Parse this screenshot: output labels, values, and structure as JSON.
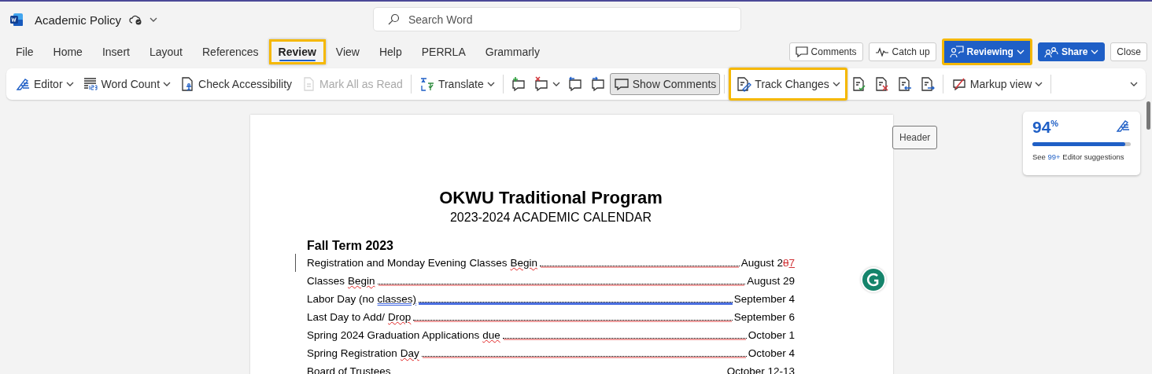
{
  "app": {
    "doc_title": "Academic Policy",
    "search_placeholder": "Search Word"
  },
  "menu_tabs": [
    {
      "label": "File",
      "selected": false,
      "highlighted": false
    },
    {
      "label": "Home",
      "selected": false,
      "highlighted": false
    },
    {
      "label": "Insert",
      "selected": false,
      "highlighted": false
    },
    {
      "label": "Layout",
      "selected": false,
      "highlighted": false
    },
    {
      "label": "References",
      "selected": false,
      "highlighted": false
    },
    {
      "label": "Review",
      "selected": true,
      "highlighted": true
    },
    {
      "label": "View",
      "selected": false,
      "highlighted": false
    },
    {
      "label": "Help",
      "selected": false,
      "highlighted": false
    },
    {
      "label": "PERRLA",
      "selected": false,
      "highlighted": false
    },
    {
      "label": "Grammarly",
      "selected": false,
      "highlighted": false
    }
  ],
  "header_buttons": [
    {
      "kind": "outline",
      "label": "Comments",
      "highlighted": false,
      "dropdown": false
    },
    {
      "kind": "outline",
      "label": "Catch up",
      "highlighted": false,
      "dropdown": false
    },
    {
      "kind": "primary",
      "label": "Reviewing",
      "highlighted": true,
      "dropdown": true
    },
    {
      "kind": "primary",
      "label": "Share",
      "highlighted": false,
      "dropdown": true
    },
    {
      "kind": "plain",
      "label": "Close",
      "highlighted": false,
      "dropdown": false
    }
  ],
  "ribbon": [
    {
      "kind": "button",
      "label": "Editor",
      "dropdown": true,
      "disabled": false,
      "selected": false,
      "highlighted": false
    },
    {
      "kind": "button",
      "label": "Word Count",
      "dropdown": true,
      "disabled": false,
      "selected": false,
      "highlighted": false
    },
    {
      "kind": "button",
      "label": "Check Accessibility",
      "dropdown": false,
      "disabled": false,
      "selected": false,
      "highlighted": false
    },
    {
      "kind": "button",
      "label": "Mark All as Read",
      "dropdown": false,
      "disabled": true,
      "selected": false,
      "highlighted": false
    },
    {
      "kind": "separator"
    },
    {
      "kind": "button",
      "label": "Translate",
      "dropdown": true,
      "disabled": false,
      "selected": false,
      "highlighted": false
    },
    {
      "kind": "separator"
    },
    {
      "kind": "icon",
      "dropdown": false,
      "disabled": false
    },
    {
      "kind": "icon",
      "dropdown": true,
      "disabled": false
    },
    {
      "kind": "icon",
      "dropdown": false,
      "disabled": false
    },
    {
      "kind": "icon",
      "dropdown": false,
      "disabled": false
    },
    {
      "kind": "button",
      "label": "Show Comments",
      "dropdown": false,
      "disabled": false,
      "selected": true,
      "highlighted": false
    },
    {
      "kind": "separator"
    },
    {
      "kind": "button",
      "label": "Track Changes",
      "dropdown": true,
      "disabled": false,
      "selected": false,
      "highlighted": true
    },
    {
      "kind": "icon",
      "dropdown": false,
      "disabled": false
    },
    {
      "kind": "icon",
      "dropdown": false,
      "disabled": false
    },
    {
      "kind": "icon",
      "dropdown": false,
      "disabled": false
    },
    {
      "kind": "icon",
      "dropdown": false,
      "disabled": false
    },
    {
      "kind": "separator"
    },
    {
      "kind": "button",
      "label": "Markup view",
      "dropdown": true,
      "disabled": false,
      "selected": false,
      "highlighted": false
    },
    {
      "kind": "separator"
    }
  ],
  "header_label": "Header",
  "editor_card": {
    "score": "94",
    "unit": "%",
    "level": 0.94,
    "prefix": "See",
    "count": "99+",
    "suffix": "Editor suggestions"
  },
  "document": {
    "title": "OKWU Traditional Program",
    "subtitle": "2023-2024 ACADEMIC CALENDAR",
    "section": "Fall Term 2023",
    "rows": [
      {
        "label": "Registration and Monday Evening Classes",
        "flagged": "Begin",
        "kind": "spelling",
        "date": "August 2",
        "deleted": "8",
        "inserted": "7",
        "changed": true
      },
      {
        "label": "Classes",
        "flagged": "Begin",
        "kind": "spelling",
        "date": "August 29",
        "changed": false
      },
      {
        "label": "Labor Day (no",
        "flagged": "classes)",
        "kind": "grammar",
        "date": "September 4",
        "changed": false
      },
      {
        "label": "Last Day to Add/",
        "flagged": "Drop",
        "kind": "spelling",
        "date": "September 6",
        "changed": false
      },
      {
        "label": "Spring 2024 Graduation Applications",
        "flagged": "due",
        "kind": "spelling",
        "date": "October 1",
        "changed": false
      },
      {
        "label": "Spring Registration",
        "flagged": "Day",
        "kind": "spelling",
        "date": "October 4",
        "changed": false
      },
      {
        "label": "Board of Trustees",
        "kind": "plain",
        "date": "October 12-13",
        "changed": false
      }
    ]
  }
}
